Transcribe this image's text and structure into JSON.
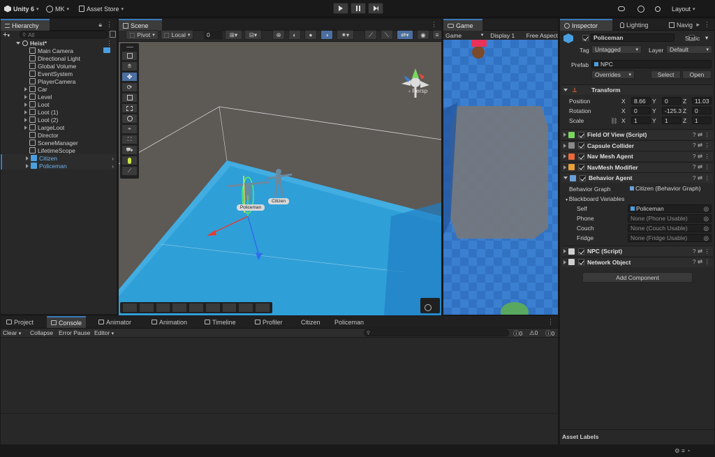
{
  "topbar": {
    "app_name": "Unity 6",
    "account": "MK",
    "asset_store": "Asset Store",
    "layout": "Layout"
  },
  "hierarchy": {
    "tab_label": "Hierarchy",
    "search_placeholder": "All",
    "scene_name": "Heist*",
    "items": [
      {
        "label": "Main Camera",
        "has_children": false,
        "prefab": false
      },
      {
        "label": "Directional Light",
        "has_children": false,
        "prefab": false
      },
      {
        "label": "Global Volume",
        "has_children": false,
        "prefab": false
      },
      {
        "label": "EventSystem",
        "has_children": false,
        "prefab": false
      },
      {
        "label": "PlayerCamera",
        "has_children": false,
        "prefab": false
      },
      {
        "label": "Car",
        "has_children": true,
        "prefab": false
      },
      {
        "label": "Level",
        "has_children": true,
        "prefab": false
      },
      {
        "label": "Loot",
        "has_children": true,
        "prefab": false
      },
      {
        "label": "Loot (1)",
        "has_children": true,
        "prefab": false
      },
      {
        "label": "Loot (2)",
        "has_children": true,
        "prefab": false
      },
      {
        "label": "LargeLoot",
        "has_children": true,
        "prefab": false
      },
      {
        "label": "Director",
        "has_children": false,
        "prefab": false
      },
      {
        "label": "SceneManager",
        "has_children": false,
        "prefab": false
      },
      {
        "label": "LifetimeScope",
        "has_children": false,
        "prefab": false
      },
      {
        "label": "Citizen",
        "has_children": true,
        "prefab": true
      },
      {
        "label": "Policeman",
        "has_children": true,
        "prefab": true
      }
    ]
  },
  "scene": {
    "tab_label": "Scene",
    "pivot": "Pivot",
    "local": "Local",
    "snap_value": "0",
    "persp_label": "Persp",
    "labels": {
      "policeman": "Policeman",
      "citizen": "Citizen"
    }
  },
  "game": {
    "tab_label": "Game",
    "view_mode": "Game",
    "display": "Display 1",
    "aspect": "Free Aspect"
  },
  "inspector": {
    "tabs": [
      "Inspector",
      "Lighting",
      "Navig"
    ],
    "object_name": "Policeman",
    "static_label": "Static",
    "tag_label": "Tag",
    "tag_value": "Untagged",
    "layer_label": "Layer",
    "layer_value": "Default",
    "prefab_label": "Prefab",
    "prefab_value": "NPC",
    "overrides": "Overrides",
    "select": "Select",
    "open": "Open",
    "transform": {
      "title": "Transform",
      "position_label": "Position",
      "rotation_label": "Rotation",
      "scale_label": "Scale",
      "position": {
        "x": "8.66",
        "y": "0",
        "z": "11.03"
      },
      "rotation": {
        "x": "0",
        "y": "-125.3",
        "z": "0"
      },
      "scale": {
        "x": "1",
        "y": "1",
        "z": "1"
      }
    },
    "components": [
      "Field Of View (Script)",
      "Capsule Collider",
      "Nav Mesh Agent",
      "NavMesh Modifier",
      "Behavior Agent"
    ],
    "behavior": {
      "graph_label": "Behavior Graph",
      "graph_value": "Citizen (Behavior Graph)",
      "blackboard_label": "Blackboard Variables",
      "vars": [
        {
          "name": "Self",
          "value": "Policeman"
        },
        {
          "name": "Phone",
          "value": "None (Phone Usable)"
        },
        {
          "name": "Couch",
          "value": "None (Couch Usable)"
        },
        {
          "name": "Fridge",
          "value": "None (Fridge Usable)"
        }
      ]
    },
    "more_components": [
      "NPC (Script)",
      "Network Object"
    ],
    "add_component": "Add Component",
    "asset_labels": "Asset Labels"
  },
  "bottom": {
    "tabs": [
      "Project",
      "Console",
      "Animator",
      "Animation",
      "Timeline",
      "Profiler",
      "Citizen",
      "Policeman"
    ],
    "console": {
      "clear": "Clear",
      "collapse": "Collapse",
      "error_pause": "Error Pause",
      "editor": "Editor",
      "counts": [
        "0",
        "0",
        "0"
      ]
    }
  },
  "colors": {
    "accent": "#3a79bb",
    "scene_floor": "#2e9bd6",
    "game_floor": "#3477c9"
  }
}
